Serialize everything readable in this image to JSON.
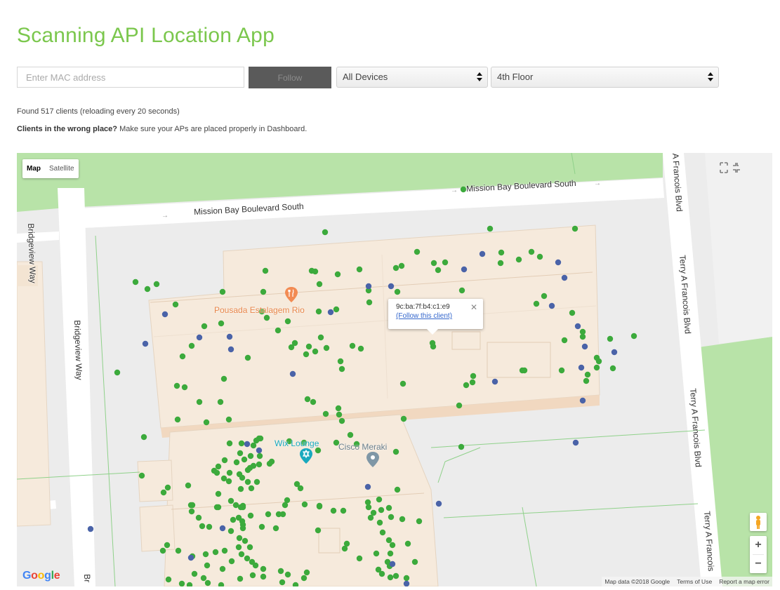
{
  "header": {
    "title": "Scanning API Location App"
  },
  "controls": {
    "mac_placeholder": "Enter MAC address",
    "follow_label": "Follow",
    "devices_selected": "All Devices",
    "floor_selected": "4th Floor"
  },
  "status": {
    "found_text": "Found 517 clients (reloading every 20 seconds)",
    "hint_bold": "Clients in the wrong place?",
    "hint_rest": " Make sure your APs are placed properly in Dashboard."
  },
  "map": {
    "type_map": "Map",
    "type_satellite": "Satellite",
    "streets": {
      "mission_bay_1": "Mission Bay Boulevard South",
      "mission_bay_2": "Mission Bay Boulevard South",
      "bridgeview_1": "Bridgeview Way",
      "bridgeview_2": "Bridgeview Way",
      "bridgeview_3": "Br",
      "francois_1": "A Francois Blvd",
      "francois_2": "Terry A Francois Blvd",
      "francois_3": "Terry A Francois Blvd",
      "francois_4": "Terry A Francois"
    },
    "pois": {
      "pousada": "Pousada Estalagem Rio",
      "wix": "Wix Lounge",
      "cisco": "Cisco Meraki"
    },
    "infowindow": {
      "mac": "9c:ba:7f:b4:c1:e9",
      "link": "(Follow this client)"
    },
    "zoom_in": "+",
    "zoom_out": "−",
    "google_letters": [
      "G",
      "o",
      "o",
      "g",
      "l",
      "e"
    ],
    "attribution": {
      "data": "Map data ©2018 Google",
      "terms": "Terms of Use",
      "report": "Report a map error"
    },
    "colors": {
      "client_dot": "#3caa3c",
      "other_dot": "#4a63a8",
      "building": "#f6eadc",
      "park": "#b8e3a8",
      "road": "#ffffff",
      "title_green": "#7bc74d"
    }
  }
}
